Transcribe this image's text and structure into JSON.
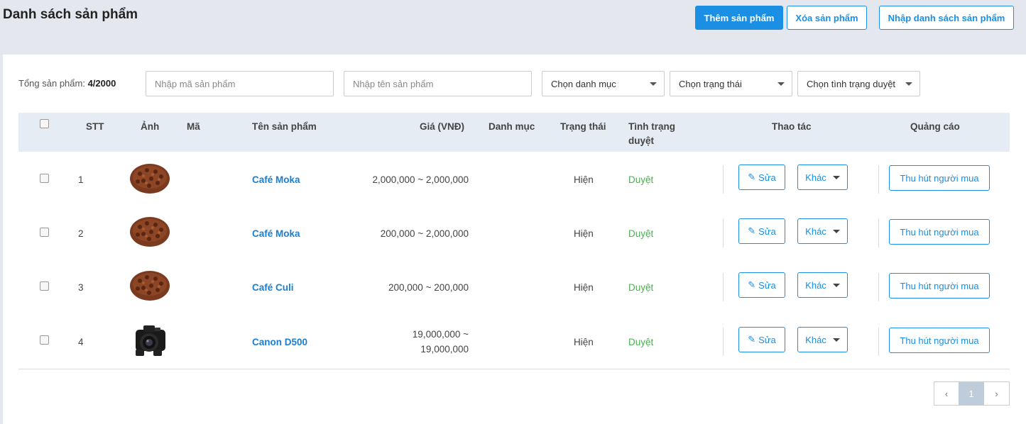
{
  "header": {
    "title": "Danh sách sản phẩm",
    "add_label": "Thêm sản phẩm",
    "delete_label": "Xóa sản phẩm",
    "import_label": "Nhập danh sách sản phẩm"
  },
  "filters": {
    "total_label": "Tổng sản phẩm:",
    "total_value": "4/2000",
    "code_placeholder": "Nhập mã sản phẩm",
    "name_placeholder": "Nhập tên sản phẩm",
    "category_select": "Chọn danh mục",
    "status_select": "Chọn trạng thái",
    "review_select": "Chọn tình trạng duyệt"
  },
  "table": {
    "columns": {
      "stt": "STT",
      "image": "Ảnh",
      "code": "Mã",
      "name": "Tên sản phẩm",
      "price": "Giá (VNĐ)",
      "category": "Danh mục",
      "status": "Trạng thái",
      "review_line1": "Tình trạng",
      "review_line2": "duyệt",
      "actions": "Thao tác",
      "ads": "Quảng cáo"
    },
    "rows": [
      {
        "stt": "1",
        "image": "coffee-beans-icon",
        "code": "",
        "name": "Café Moka",
        "price": "2,000,000 ~ 2,000,000",
        "price2": "",
        "category": "",
        "status": "Hiện",
        "review": "Duyệt",
        "edit": "Sửa",
        "more": "Khác",
        "ad": "Thu hút người mua"
      },
      {
        "stt": "2",
        "image": "coffee-beans-icon",
        "code": "",
        "name": "Café Moka",
        "price": "200,000 ~ 2,000,000",
        "price2": "",
        "category": "",
        "status": "Hiện",
        "review": "Duyệt",
        "edit": "Sửa",
        "more": "Khác",
        "ad": "Thu hút người mua"
      },
      {
        "stt": "3",
        "image": "coffee-beans-icon",
        "code": "",
        "name": "Café Culi",
        "price": "200,000 ~ 200,000",
        "price2": "",
        "category": "",
        "status": "Hiện",
        "review": "Duyệt",
        "edit": "Sửa",
        "more": "Khác",
        "ad": "Thu hút người mua"
      },
      {
        "stt": "4",
        "image": "camera-icon",
        "code": "",
        "name": "Canon D500",
        "price": "19,000,000 ~",
        "price2": "19,000,000",
        "category": "",
        "status": "Hiện",
        "review": "Duyệt",
        "edit": "Sửa",
        "more": "Khác",
        "ad": "Thu hút người mua"
      }
    ]
  },
  "pagination": {
    "prev": "‹",
    "current": "1",
    "next": "›"
  },
  "colors": {
    "primary": "#1a8fe3",
    "approve": "#4caf50",
    "header_bg": "#e4e8ee"
  }
}
